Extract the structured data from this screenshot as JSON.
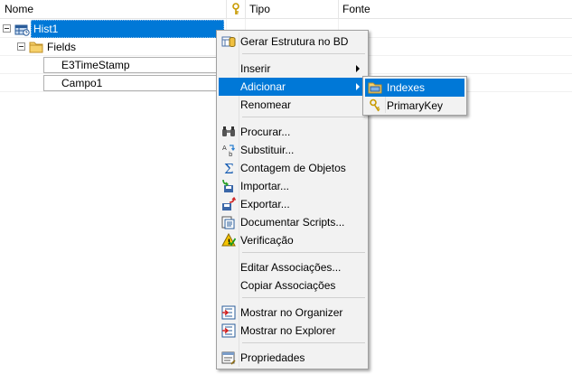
{
  "columns": {
    "nome": "Nome",
    "tipo": "Tipo",
    "fonte": "Fonte",
    "key_icon": "key-icon"
  },
  "tree": {
    "root": {
      "label": "Hist1",
      "icon": "historic-table-icon"
    },
    "fields": {
      "label": "Fields",
      "icon": "folder-icon"
    },
    "items": [
      {
        "label": "E3TimeStamp",
        "icon": "field-icon"
      },
      {
        "label": "Campo1",
        "icon": "field-icon"
      }
    ]
  },
  "context_menu": {
    "gerar": "Gerar Estrutura no BD",
    "inserir": "Inserir",
    "adicionar": "Adicionar",
    "renomear": "Renomear",
    "procurar": "Procurar...",
    "substituir": "Substituir...",
    "contagem": "Contagem de Objetos",
    "importar": "Importar...",
    "exportar": "Exportar...",
    "documentar": "Documentar Scripts...",
    "verificacao": "Verificação",
    "editar_assoc": "Editar Associações...",
    "copiar_assoc": "Copiar Associações",
    "mostrar_organizer": "Mostrar no Organizer",
    "mostrar_explorer": "Mostrar no Explorer",
    "propriedades": "Propriedades"
  },
  "submenu": {
    "indexes": "Indexes",
    "primary_key": "PrimaryKey"
  },
  "colors": {
    "selection": "#0078d7",
    "menu_background": "#f2f2f2"
  }
}
